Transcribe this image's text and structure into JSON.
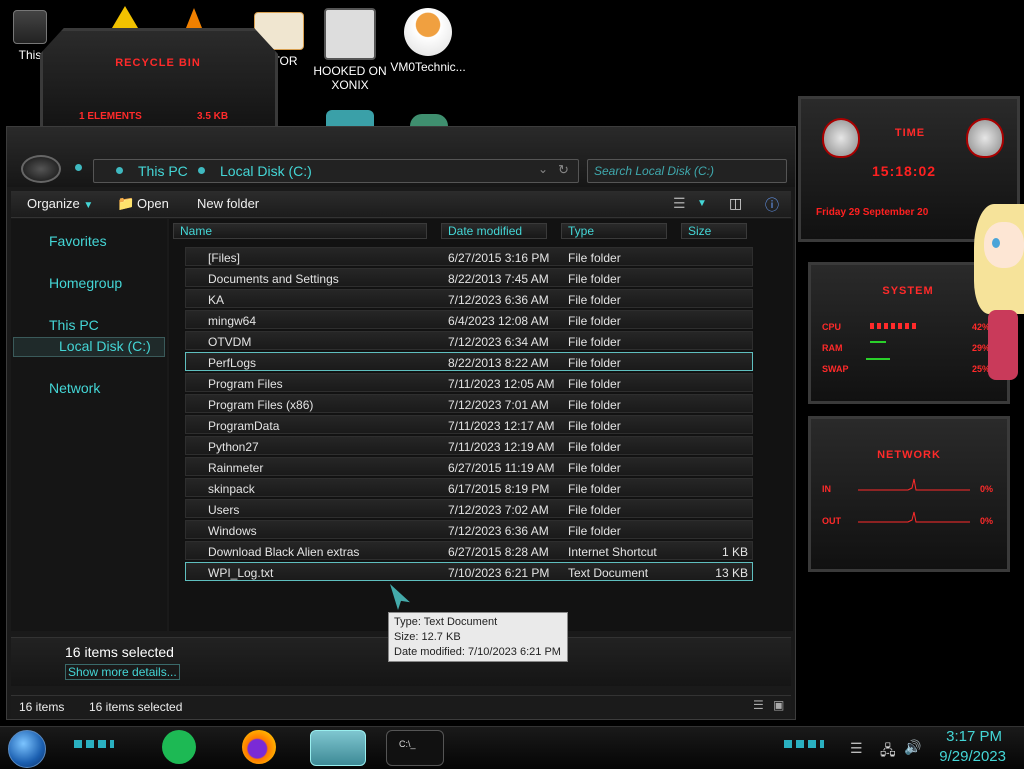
{
  "desktop": {
    "icons": [
      {
        "label": "This"
      },
      {
        "label": "DITOR"
      },
      {
        "label": "HOOKED ON XONIX"
      },
      {
        "label": "VM0Technic..."
      }
    ]
  },
  "recycle_bin": {
    "title": "RECYCLE BIN",
    "count": "1 ELEMENTS",
    "size": "3.5 KB"
  },
  "explorer": {
    "address": {
      "segment1": "This PC",
      "segment2": "Local Disk (C:)"
    },
    "search_placeholder": "Search Local Disk (C:)",
    "toolbar": {
      "organize": "Organize",
      "open": "Open",
      "new_folder": "New folder"
    },
    "nav": {
      "favorites": "Favorites",
      "homegroup": "Homegroup",
      "this_pc": "This PC",
      "local_disk": "Local Disk (C:)",
      "network": "Network"
    },
    "columns": {
      "name": "Name",
      "date": "Date modified",
      "type": "Type",
      "size": "Size"
    },
    "rows": [
      {
        "name": "[Files]",
        "date": "6/27/2015 3:16 PM",
        "type": "File folder",
        "size": ""
      },
      {
        "name": "Documents and Settings",
        "date": "8/22/2013 7:45 AM",
        "type": "File folder",
        "size": ""
      },
      {
        "name": "KA",
        "date": "7/12/2023 6:36 AM",
        "type": "File folder",
        "size": ""
      },
      {
        "name": "mingw64",
        "date": "6/4/2023 12:08 AM",
        "type": "File folder",
        "size": ""
      },
      {
        "name": "OTVDM",
        "date": "7/12/2023 6:34 AM",
        "type": "File folder",
        "size": ""
      },
      {
        "name": "PerfLogs",
        "date": "8/22/2013 8:22 AM",
        "type": "File folder",
        "size": ""
      },
      {
        "name": "Program Files",
        "date": "7/11/2023 12:05 AM",
        "type": "File folder",
        "size": ""
      },
      {
        "name": "Program Files (x86)",
        "date": "7/12/2023 7:01 AM",
        "type": "File folder",
        "size": ""
      },
      {
        "name": "ProgramData",
        "date": "7/11/2023 12:17 AM",
        "type": "File folder",
        "size": ""
      },
      {
        "name": "Python27",
        "date": "7/11/2023 12:19 AM",
        "type": "File folder",
        "size": ""
      },
      {
        "name": "Rainmeter",
        "date": "6/27/2015 11:19 AM",
        "type": "File folder",
        "size": ""
      },
      {
        "name": "skinpack",
        "date": "6/17/2015 8:19 PM",
        "type": "File folder",
        "size": ""
      },
      {
        "name": "Users",
        "date": "7/12/2023 7:02 AM",
        "type": "File folder",
        "size": ""
      },
      {
        "name": "Windows",
        "date": "7/12/2023 6:36 AM",
        "type": "File folder",
        "size": ""
      },
      {
        "name": "Download Black Alien extras",
        "date": "6/27/2015 8:28 AM",
        "type": "Internet Shortcut",
        "size": "1 KB"
      },
      {
        "name": "WPI_Log.txt",
        "date": "7/10/2023 6:21 PM",
        "type": "Text Document",
        "size": "13 KB"
      }
    ],
    "tooltip": {
      "type": "Type: Text Document",
      "size": "Size: 12.7 KB",
      "date": "Date modified: 7/10/2023 6:21 PM"
    },
    "details": {
      "selected": "16 items selected",
      "more": "Show more details..."
    },
    "status": {
      "items": "16 items",
      "selected": "16 items selected"
    }
  },
  "gadgets": {
    "clock": {
      "title": "TIME",
      "time": "15:18:02",
      "date": "Friday 29 September 20"
    },
    "system": {
      "title": "SYSTEM",
      "cpu_label": "CPU",
      "cpu_val": "42%",
      "ram_label": "RAM",
      "ram_val": "29%",
      "swap_label": "SWAP",
      "swap_val": "25%"
    },
    "network": {
      "title": "NETWORK",
      "in_label": "IN",
      "in_val": "0%",
      "out_label": "OUT",
      "out_val": "0%"
    }
  },
  "taskbar": {
    "time": "3:17 PM",
    "date": "9/29/2023"
  },
  "colors": {
    "accent": "#44d6d6",
    "red": "#ff2a2a"
  }
}
